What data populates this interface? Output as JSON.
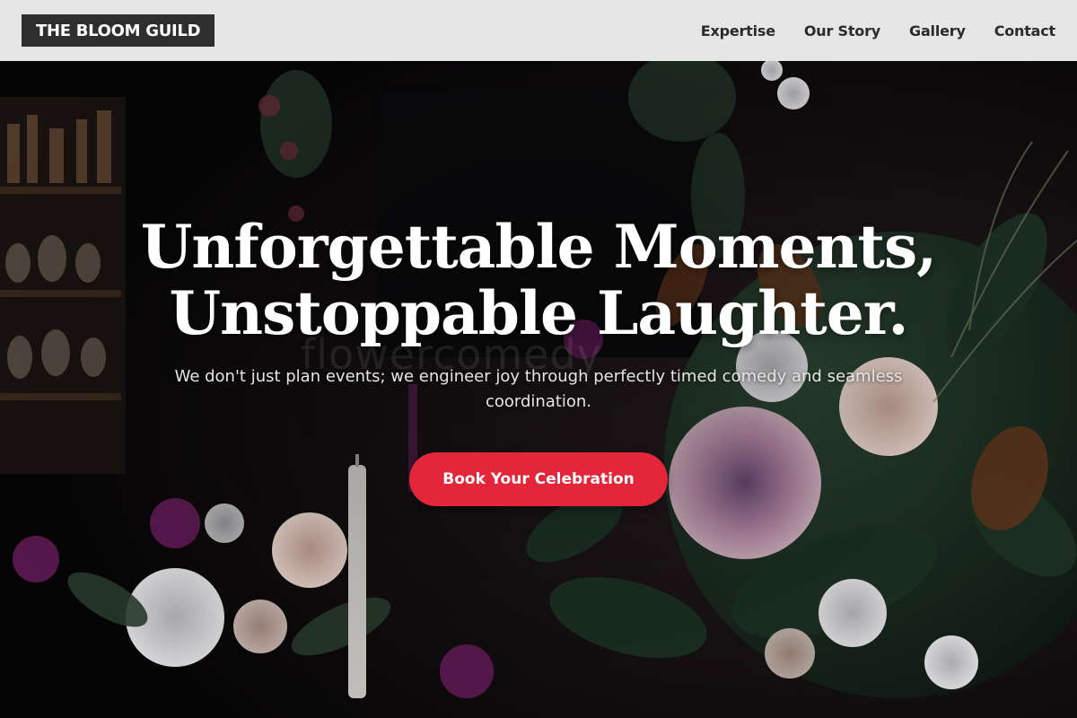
{
  "header": {
    "logo_text": "THE BLOOM GUILD",
    "nav": [
      {
        "label": "Expertise"
      },
      {
        "label": "Our Story"
      },
      {
        "label": "Gallery"
      },
      {
        "label": "Contact"
      }
    ]
  },
  "hero": {
    "title_line_1": "Unforgettable Moments,",
    "title_line_2": "Unstoppable Laughter.",
    "subtitle": "We don't just plan events; we engineer joy through perfectly timed comedy and seamless coordination.",
    "cta_label": "Book Your Celebration",
    "watermark_text": "flowercomedy"
  },
  "colors": {
    "header_bg": "#e6e6e6",
    "logo_bg": "#2e2e2e",
    "cta_bg": "#e3263a"
  }
}
